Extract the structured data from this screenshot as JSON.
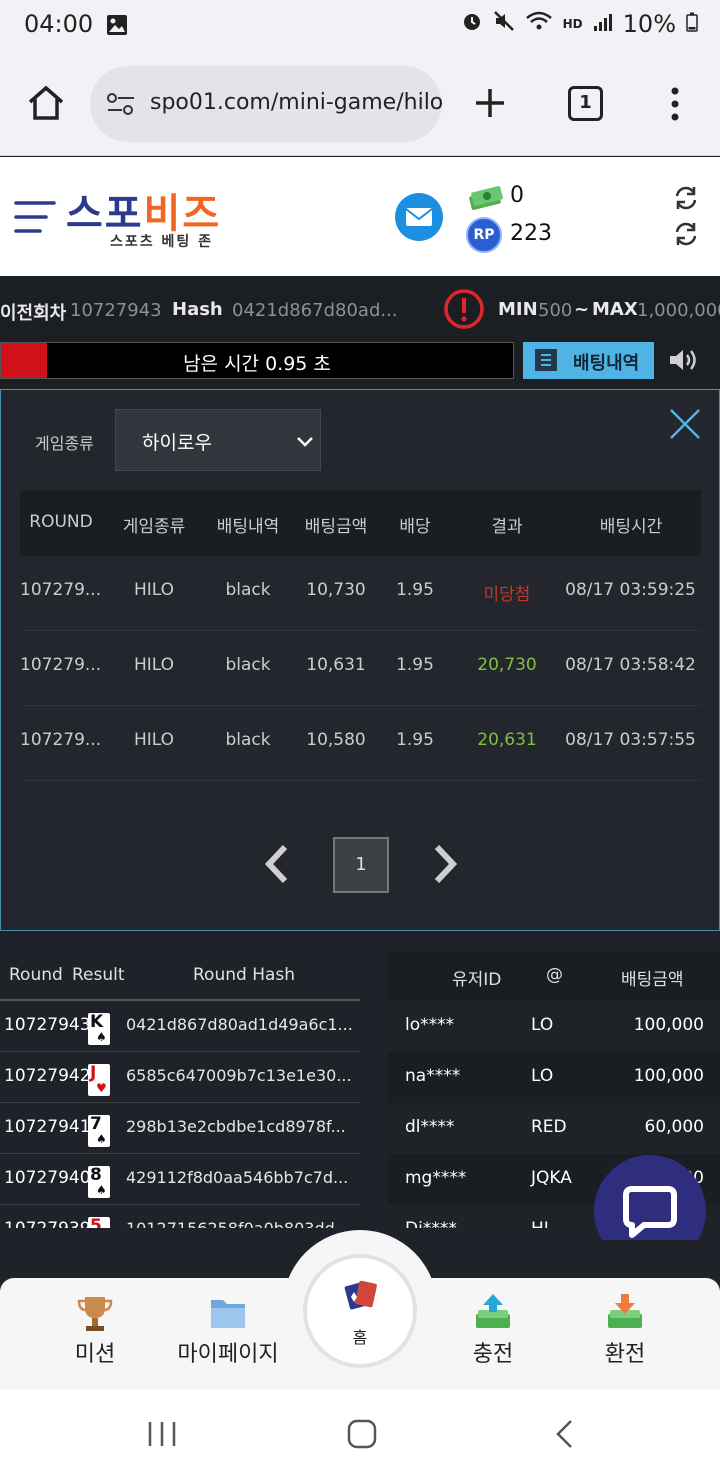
{
  "status_bar": {
    "time": "04:00",
    "battery": "10%",
    "hd_label": "HD"
  },
  "browser": {
    "url": "spo01.com/mini-game/hilo",
    "tab_count": "1"
  },
  "header": {
    "logo_text_a": "스포",
    "logo_text_b": "비즈",
    "logo_sub": "스포츠 베팅 존",
    "money_value": "0",
    "point_value": "223",
    "point_badge": "RP"
  },
  "info": {
    "prev_round_label": "이전회차",
    "prev_round_value": "10727943",
    "hash_label": "Hash",
    "hash_value": "0421d867d80ad...",
    "min_label": "MIN",
    "min_value": "500",
    "tilde": "~",
    "max_label": "MAX",
    "max_value": "1,000,000"
  },
  "timer": {
    "text": "남은 시간 0.95 초",
    "fill_fraction": 0.09
  },
  "bet_history_button": "배팅내역",
  "modal": {
    "game_type_label": "게임종류",
    "game_type_selected": "하이로우",
    "columns": [
      "ROUND",
      "게임종류",
      "배팅내역",
      "배팅금액",
      "배당",
      "결과",
      "배팅시간"
    ],
    "rows": [
      {
        "round": "107279...",
        "game": "HILO",
        "bet": "black",
        "amount": "10,730",
        "odds": "1.95",
        "result": "미당첨",
        "time": "08/17 03:59:25",
        "result_color": "#c0392b"
      },
      {
        "round": "107279...",
        "game": "HILO",
        "bet": "black",
        "amount": "10,631",
        "odds": "1.95",
        "result": "20,730",
        "time": "08/17 03:58:42",
        "result_color": "#7cc043"
      },
      {
        "round": "107279...",
        "game": "HILO",
        "bet": "black",
        "amount": "10,580",
        "odds": "1.95",
        "result": "20,631",
        "time": "08/17 03:57:55",
        "result_color": "#7cc043"
      }
    ],
    "page": "1"
  },
  "round_table": {
    "headers": {
      "round": "Round",
      "result": "Result",
      "hash": "Round Hash"
    },
    "rows": [
      {
        "round": "10727943",
        "card_rank": "K",
        "card_suit": "♠",
        "suit_color": "#111",
        "hash": "0421d867d80ad1d49a6c1..."
      },
      {
        "round": "10727942",
        "card_rank": "J",
        "card_suit": "♥",
        "suit_color": "#d0111a",
        "hash": "6585c647009b7c13e1e30..."
      },
      {
        "round": "10727941",
        "card_rank": "7",
        "card_suit": "♠",
        "suit_color": "#111",
        "hash": "298b13e2cbdbe1cd8978f..."
      },
      {
        "round": "10727940",
        "card_rank": "8",
        "card_suit": "♠",
        "suit_color": "#111",
        "hash": "429112f8d0aa546bb7c7d..."
      },
      {
        "round": "10727939",
        "card_rank": "5",
        "card_suit": "♥",
        "suit_color": "#d0111a",
        "hash": "10127156258f0a0b803dd..."
      }
    ]
  },
  "user_table": {
    "headers": {
      "user": "유저ID",
      "at": "@",
      "amount": "배팅금액"
    },
    "rows": [
      {
        "user": "lo****",
        "pick": "LO",
        "amount": "100,000"
      },
      {
        "user": "na****",
        "pick": "LO",
        "amount": "100,000"
      },
      {
        "user": "dl****",
        "pick": "RED",
        "amount": "60,000"
      },
      {
        "user": "mg****",
        "pick": "JQKA",
        "amount": "50,000"
      },
      {
        "user": "Dj****",
        "pick": "HI",
        "amount": ""
      }
    ]
  },
  "bottom_nav": {
    "mission": "미션",
    "mypage": "마이페이지",
    "home": "홈",
    "deposit": "충전",
    "withdraw": "환전"
  },
  "colors": {
    "accent_blue": "#4fb3e4",
    "timer_red": "#d0111a",
    "logo_blue": "#2b3a8c",
    "logo_orange": "#f26522",
    "chat_purple": "#2f2d7e"
  }
}
